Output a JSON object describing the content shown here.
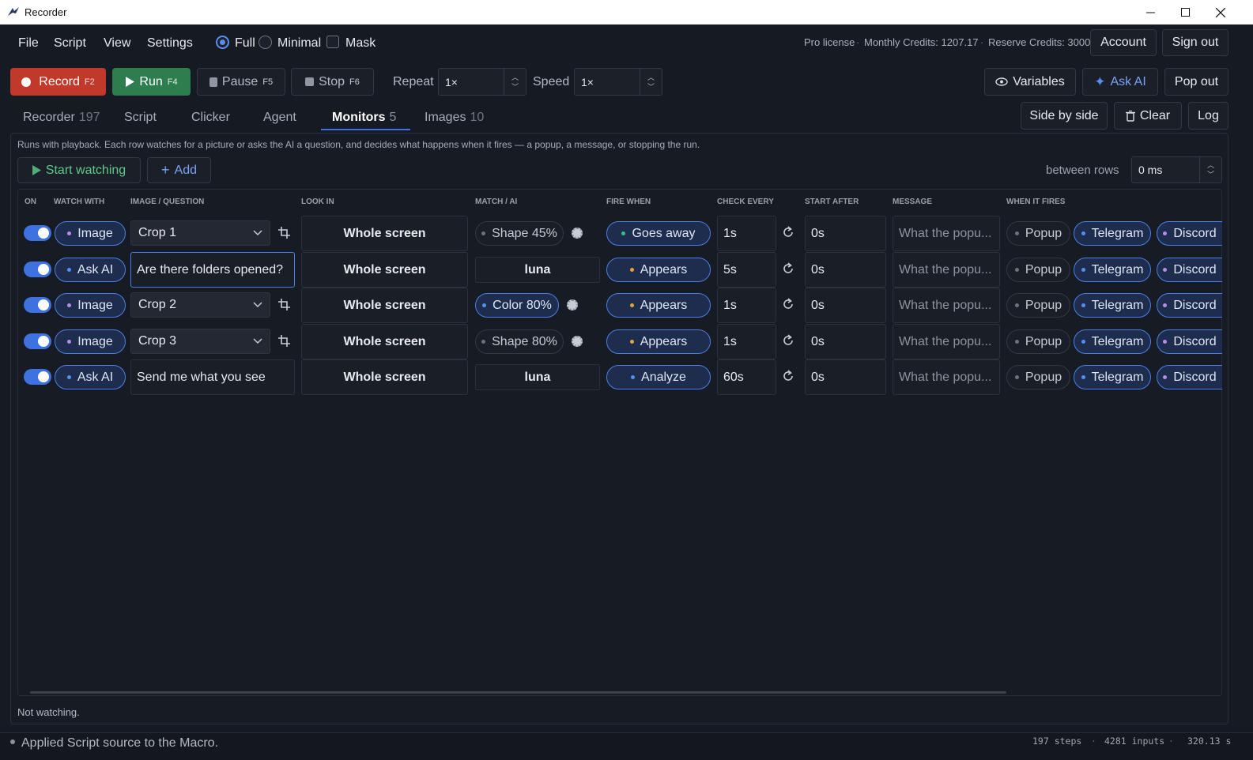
{
  "window": {
    "title": "Recorder"
  },
  "menu": {
    "file": "File",
    "script": "Script",
    "view": "View",
    "settings": "Settings",
    "modes": [
      "Full",
      "Minimal",
      "Mask"
    ]
  },
  "license": {
    "text": "Pro license",
    "credits": "Monthly Credits: 1207.17",
    "reserve": "Reserve Credits: 3000",
    "account": "Account",
    "sign_out": "Sign out"
  },
  "toolbar": {
    "record": {
      "label": "Record",
      "key": "F2"
    },
    "run": {
      "label": "Run",
      "key": "F4"
    },
    "pause": {
      "label": "Pause",
      "key": "F5"
    },
    "stop": {
      "label": "Stop",
      "key": "F6"
    },
    "repeat_label": "Repeat",
    "repeat_value": "1×",
    "speed_label": "Speed",
    "speed_value": "1×",
    "variables": "Variables",
    "ask_ai": "Ask AI",
    "pop_out": "Pop out",
    "side_by_side": "Side by side",
    "clear": "Clear",
    "log": "Log"
  },
  "tabs": [
    {
      "label": "Recorder",
      "count": "197"
    },
    {
      "label": "Script",
      "count": ""
    },
    {
      "label": "Clicker",
      "count": ""
    },
    {
      "label": "Agent",
      "count": ""
    },
    {
      "label": "Monitors",
      "count": "5"
    },
    {
      "label": "Images",
      "count": "10"
    }
  ],
  "monitors": {
    "hint": "Runs with playback. Each row watches for a picture or asks the AI a question, and decides what happens when it fires — a popup, a message, or stopping the run.",
    "start_watching": "Start watching",
    "add": "Add",
    "between_rows_label": "between rows",
    "between_rows_value": "0 ms",
    "columns": [
      "ON",
      "WATCH WITH",
      "IMAGE / QUESTION",
      "LOOK IN",
      "MATCH / AI",
      "FIRE WHEN",
      "CHECK EVERY",
      "START AFTER",
      "MESSAGE",
      "WHEN IT FIRES"
    ],
    "rows": [
      {
        "watch": "Image",
        "question": "Crop 1",
        "look_in": "Whole screen",
        "match": "Shape 45%",
        "fire": "Goes away",
        "every": "1s",
        "after": "0s",
        "message": "What the popu...",
        "popup": "Popup",
        "telegram": "Telegram",
        "discord": "Discord"
      },
      {
        "watch": "Ask AI",
        "question": "Are there folders opened?",
        "look_in": "Whole screen",
        "match": "luna",
        "fire": "Appears",
        "every": "5s",
        "after": "0s",
        "message": "What the popu...",
        "popup": "Popup",
        "telegram": "Telegram",
        "discord": "Discord"
      },
      {
        "watch": "Image",
        "question": "Crop 2",
        "look_in": "Whole screen",
        "match": "Color 80%",
        "fire": "Appears",
        "every": "1s",
        "after": "0s",
        "message": "What the popu...",
        "popup": "Popup",
        "telegram": "Telegram",
        "discord": "Discord"
      },
      {
        "watch": "Image",
        "question": "Crop 3",
        "look_in": "Whole screen",
        "match": "Shape 80%",
        "fire": "Appears",
        "every": "1s",
        "after": "0s",
        "message": "What the popu...",
        "popup": "Popup",
        "telegram": "Telegram",
        "discord": "Discord"
      },
      {
        "watch": "Ask AI",
        "question": "Send me what you see",
        "look_in": "Whole screen",
        "match": "luna",
        "fire": "Analyze",
        "every": "60s",
        "after": "0s",
        "message": "What the popu...",
        "popup": "Popup",
        "telegram": "Telegram",
        "discord": "Discord"
      }
    ],
    "status": "Not watching."
  },
  "statusbar": {
    "message": "Applied Script source to the Macro.",
    "steps": "197 steps",
    "inputs": "4281 inputs",
    "seconds": "320.13 s"
  },
  "colors": {
    "accent": "#3d72e0",
    "record": "#c0392b",
    "run": "#2e7d4f",
    "dot_purple": "#b48ee6",
    "dot_blue": "#5b8cf0",
    "dot_orange": "#e6a23c",
    "dot_green": "#39c08a"
  }
}
